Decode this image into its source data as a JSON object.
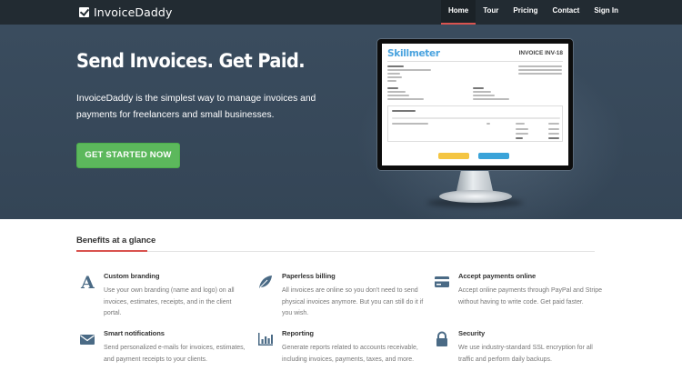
{
  "brand": {
    "name": "InvoiceDaddy",
    "icon": "check-box-icon"
  },
  "nav": [
    {
      "label": "Home",
      "active": true
    },
    {
      "label": "Tour",
      "active": false
    },
    {
      "label": "Pricing",
      "active": false
    },
    {
      "label": "Contact",
      "active": false
    },
    {
      "label": "Sign In",
      "active": false
    }
  ],
  "hero": {
    "title": "Send Invoices. Get Paid.",
    "subtitle": "InvoiceDaddy is the simplest way to manage invoices and payments for freelancers and small businesses.",
    "cta_label": "GET STARTED NOW"
  },
  "invoice_preview": {
    "logo": "Skillmeter",
    "title": "INVOICE INV-18",
    "section": "Order summary",
    "pay_paypal": "Pay with PayPal",
    "pay_card": "Pay with Credit Card"
  },
  "benefits": {
    "title": "Benefits at a glance",
    "items": [
      {
        "icon": "font-icon",
        "title": "Custom branding",
        "desc": "Use your own branding (name and logo) on all invoices, estimates, receipts, and in the client portal."
      },
      {
        "icon": "leaf-icon",
        "title": "Paperless billing",
        "desc": "All invoices are online so you don't need to send physical invoices anymore. But you can still do it if you wish."
      },
      {
        "icon": "credit-card-icon",
        "title": "Accept payments online",
        "desc": "Accept online payments through PayPal and Stripe without having to write code. Get paid faster."
      },
      {
        "icon": "envelope-icon",
        "title": "Smart notifications",
        "desc": "Send personalized e-mails for invoices, estimates, and payment receipts to your clients."
      },
      {
        "icon": "bar-chart-icon",
        "title": "Reporting",
        "desc": "Generate reports related to accounts receivable, including invoices, payments, taxes, and more."
      },
      {
        "icon": "lock-icon",
        "title": "Security",
        "desc": "We use industry-standard SSL encryption for all traffic and perform daily backups."
      }
    ]
  },
  "colors": {
    "nav_bg": "#222b32",
    "hero_bg": "#3a4c5e",
    "accent": "#d9534f",
    "cta": "#5cb85c",
    "icon": "#4a6a85"
  }
}
